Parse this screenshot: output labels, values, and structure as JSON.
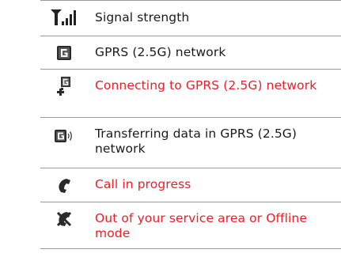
{
  "rows": [
    {
      "icon": "signal-strength-icon",
      "text": "Signal strength",
      "color": "#1a1a1a"
    },
    {
      "icon": "gprs-network-icon",
      "text": "GPRS (2.5G) network",
      "color": "#1a1a1a"
    },
    {
      "icon": "gprs-connecting-icon",
      "text": "Connecting to GPRS (2.5G) network",
      "color": "#ee1c25"
    },
    {
      "icon": "gprs-transferring-icon",
      "text": "Transferring data in GPRS (2.5G) network",
      "color": "#1a1a1a"
    },
    {
      "icon": "call-in-progress-icon",
      "text": "Call in progress",
      "color": "#ee1c25"
    },
    {
      "icon": "no-service-icon",
      "text": "Out of your service area or Offline mode",
      "color": "#ee1c25"
    }
  ]
}
